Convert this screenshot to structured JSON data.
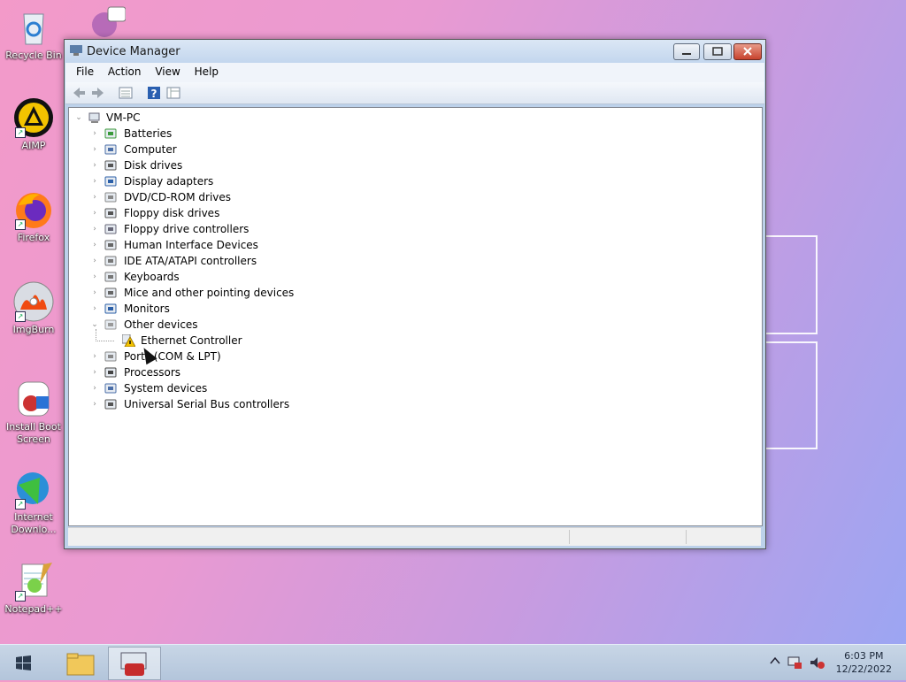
{
  "desktop": {
    "icons": [
      {
        "label": "Recycle Bin",
        "icon": "recycle-bin-icon"
      },
      {
        "label": "AIMP",
        "icon": "aimp-icon"
      },
      {
        "label": "Firefox",
        "icon": "firefox-icon"
      },
      {
        "label": "ImgBurn",
        "icon": "imgburn-icon"
      },
      {
        "label": "Install Boot Screen",
        "icon": "install-boot-screen-icon"
      },
      {
        "label": "Internet Downlo...",
        "icon": "internet-download-manager-icon"
      },
      {
        "label": "Notepad++",
        "icon": "notepad-plus-plus-icon"
      }
    ]
  },
  "window": {
    "title": "Device Manager",
    "menu": [
      "File",
      "Action",
      "View",
      "Help"
    ],
    "toolbar": [
      "back-icon",
      "forward-icon",
      "properties-view-icon",
      "help-icon",
      "resources-view-icon"
    ],
    "tree": {
      "root": "VM-PC",
      "categories": [
        {
          "label": "Batteries",
          "icon": "battery-icon",
          "expanded": false
        },
        {
          "label": "Computer",
          "icon": "computer-icon",
          "expanded": false
        },
        {
          "label": "Disk drives",
          "icon": "disk-drive-icon",
          "expanded": false
        },
        {
          "label": "Display adapters",
          "icon": "display-adapter-icon",
          "expanded": false
        },
        {
          "label": "DVD/CD-ROM drives",
          "icon": "dvd-drive-icon",
          "expanded": false
        },
        {
          "label": "Floppy disk drives",
          "icon": "floppy-disk-icon",
          "expanded": false
        },
        {
          "label": "Floppy drive controllers",
          "icon": "floppy-controller-icon",
          "expanded": false
        },
        {
          "label": "Human Interface Devices",
          "icon": "hid-icon",
          "expanded": false
        },
        {
          "label": "IDE ATA/ATAPI controllers",
          "icon": "ide-controller-icon",
          "expanded": false
        },
        {
          "label": "Keyboards",
          "icon": "keyboard-icon",
          "expanded": false
        },
        {
          "label": "Mice and other pointing devices",
          "icon": "mouse-icon",
          "expanded": false
        },
        {
          "label": "Monitors",
          "icon": "monitor-icon",
          "expanded": false
        },
        {
          "label": "Other devices",
          "icon": "unknown-device-icon",
          "expanded": true,
          "children": [
            {
              "label": "Ethernet Controller",
              "icon": "warning-device-icon"
            }
          ]
        },
        {
          "label": "Ports (COM & LPT)",
          "icon": "port-icon",
          "expanded": false
        },
        {
          "label": "Processors",
          "icon": "processor-icon",
          "expanded": false
        },
        {
          "label": "System devices",
          "icon": "system-device-icon",
          "expanded": false
        },
        {
          "label": "Universal Serial Bus controllers",
          "icon": "usb-icon",
          "expanded": false
        }
      ]
    }
  },
  "taskbar": {
    "time": "6:03 PM",
    "date": "12/22/2022"
  },
  "colors": {
    "accent": "#3a6ea5",
    "close": "#c7432e"
  }
}
